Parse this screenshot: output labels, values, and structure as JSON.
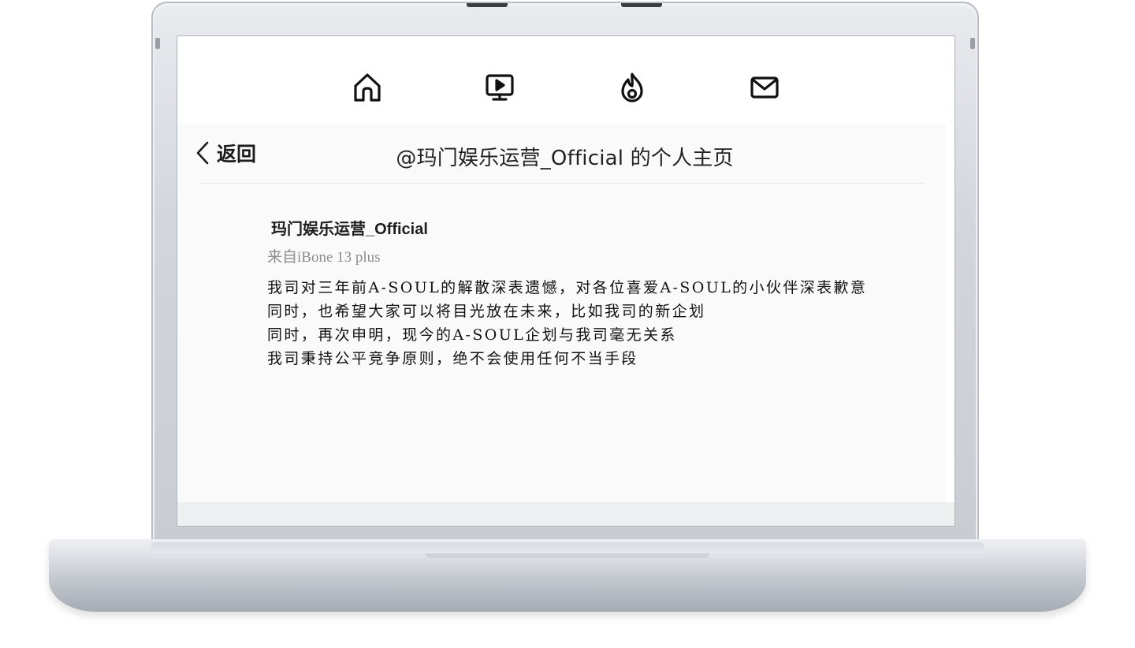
{
  "nav": {
    "items": [
      {
        "icon": "home-icon"
      },
      {
        "icon": "video-icon"
      },
      {
        "icon": "trending-icon"
      },
      {
        "icon": "mail-icon"
      }
    ]
  },
  "header": {
    "back_label": "返回",
    "title": "@玛门娱乐运营_Official 的个人主页"
  },
  "post": {
    "author": "玛门娱乐运营_Official",
    "device": "来自iBone 13 plus",
    "lines": [
      "我司对三年前A-SOUL的解散深表遗憾，对各位喜爱A-SOUL的小伙伴深表歉意",
      "同时，也希望大家可以将目光放在未来，比如我司的新企划",
      "同时，再次申明，现今的A-SOUL企划与我司毫无关系",
      "我司秉持公平竞争原则，绝不会使用任何不当手段"
    ]
  },
  "colors": {
    "text_primary": "#1b1b1b",
    "text_secondary": "#8d8d8d",
    "panel_bg": "#fafafa",
    "laptop_silver": "#d3d6dc"
  }
}
